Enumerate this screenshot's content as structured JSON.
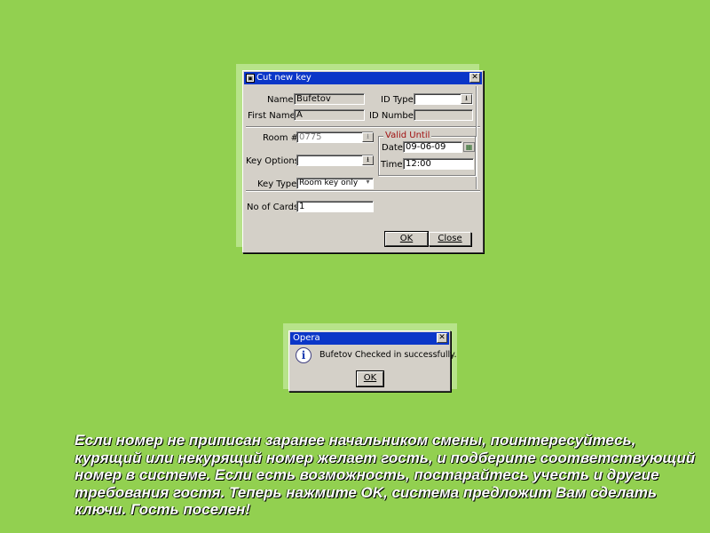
{
  "cut_key_dialog": {
    "title": "Cut new key",
    "name_label": "Name",
    "name_value": "Bufetov",
    "first_name_label": "First Name",
    "first_name_value": "A",
    "id_type_label": "ID Type",
    "id_type_value": "",
    "id_number_label": "ID Number",
    "id_number_value": "",
    "room_label": "Room #",
    "room_value": "0775",
    "key_options_label": "Key Options",
    "key_options_value": "",
    "key_type_label": "Key Type",
    "key_type_value": "Room key only",
    "no_of_cards_label": "No of Cards",
    "no_of_cards_value": "1",
    "valid_until_title": "Valid Until",
    "date_label": "Date",
    "date_value": "09-06-09",
    "time_label": "Time",
    "time_value": "12:00",
    "ok_label": "OK",
    "close_label": "Close"
  },
  "opera_dialog": {
    "title": "Opera",
    "message": "Bufetov Checked in successfully.",
    "ok_label": "OK"
  },
  "caption": "Если номер не приписан заранее начальником смены, поинтересуйтесь, курящий или некурящий номер желает гость, и подберите соответствующий номер в системе. Если есть возможность, постарайтесь учесть и другие требования гостя. Теперь нажмите OK, система предложит Вам сделать ключи. Гость поселен!",
  "colors": {
    "background": "#92d050",
    "titlebar": "#0a36c8",
    "window_face": "#d4d0c8",
    "group_title": "#a01010"
  },
  "icons": [
    "app-window-icon",
    "close-icon",
    "dropdown-arrow-icon",
    "calendar-icon",
    "info-icon"
  ]
}
